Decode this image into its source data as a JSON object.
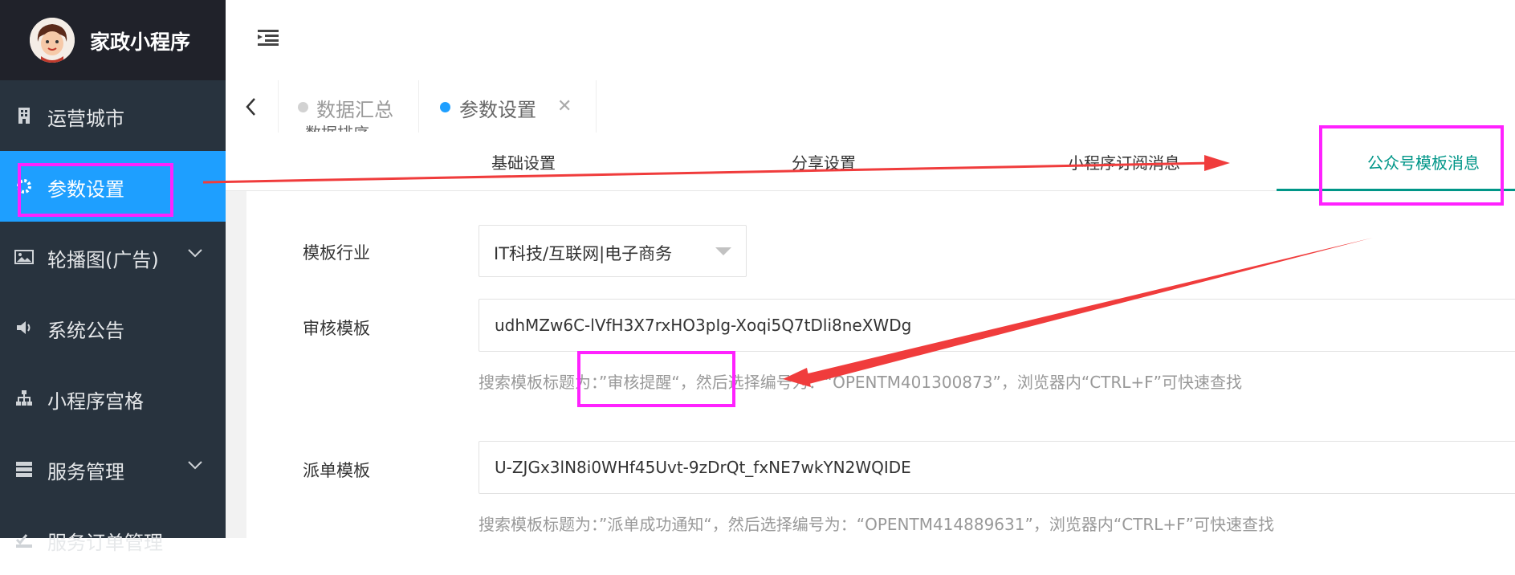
{
  "app": {
    "name": "家政小程序"
  },
  "sidebar": {
    "items": [
      {
        "label": "运营城市",
        "icon": "building-icon"
      },
      {
        "label": "参数设置",
        "icon": "gear-icon",
        "active": true
      },
      {
        "label": "轮播图(广告)",
        "icon": "image-icon",
        "expandable": true
      },
      {
        "label": "系统公告",
        "icon": "speaker-icon"
      },
      {
        "label": "小程序宫格",
        "icon": "sitemap-icon"
      },
      {
        "label": "服务管理",
        "icon": "server-icon",
        "expandable": true
      },
      {
        "label": "服务订单管理",
        "icon": "checklist-icon"
      }
    ]
  },
  "tabs": [
    {
      "label": "数据汇总",
      "active": false
    },
    {
      "label": "参数设置",
      "active": true,
      "closable": true
    }
  ],
  "subtabs": {
    "cut_label": "数据排序",
    "items": [
      "基础设置",
      "分享设置",
      "小程序订阅消息",
      "公众号模板消息"
    ],
    "active_index": 3
  },
  "form": {
    "industry": {
      "label": "模板行业",
      "value": "IT科技/互联网|电子商务"
    },
    "audit": {
      "label": "审核模板",
      "value": "udhMZw6C-lVfH3X7rxHO3pIg-Xoqi5Q7tDli8neXWDg",
      "hint": "搜索模板标题为：”审核提醒“，然后选择编号为：“OPENTM401300873”，浏览器内“CTRL+F”可快速查找"
    },
    "dispatch": {
      "label": "派单模板",
      "value": "U-ZJGx3lN8i0WHf45Uvt-9zDrQt_fxNE7wkYN2WQIDE",
      "hint": "搜索模板标题为：”派单成功通知“，然后选择编号为：“OPENTM414889631”，浏览器内“CTRL+F”可快速查找"
    }
  },
  "colors": {
    "sidebar_bg": "#28333e",
    "brand_bg": "#20222a",
    "active_blue": "#1e9fff",
    "active_green": "#009688",
    "annotation_magenta": "#ff22ff",
    "annotation_red": "#f03c3c"
  }
}
